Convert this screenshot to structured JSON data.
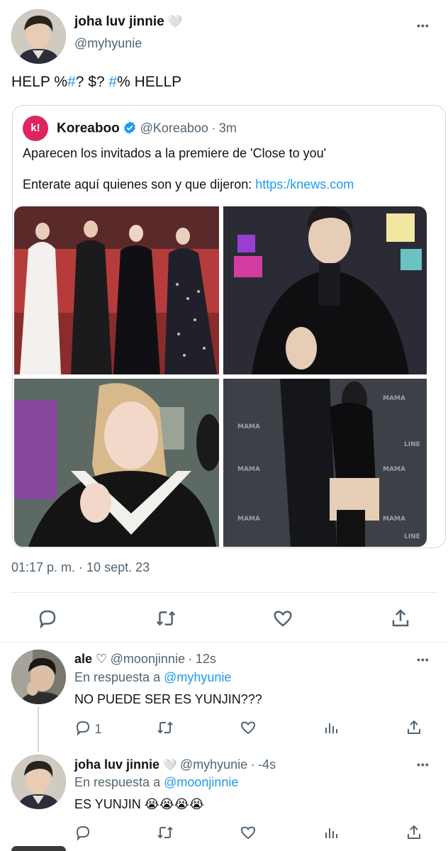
{
  "main_tweet": {
    "display_name": "joha luv jinnie",
    "heart_emoji": "🤍",
    "handle": "@myhyunie",
    "more_label": "•••",
    "text_parts": [
      "HELP %",
      "#",
      "? $? ",
      "#",
      "% HELLP"
    ],
    "quote": {
      "avatar_letter": "k!",
      "display_name": "Koreaboo",
      "handle": "@Koreaboo",
      "separator": "·",
      "time": "3m",
      "line1": "Aparecen los invitados a la premiere de 'Close to you'",
      "line2_prefix": "Enterate aquí quienes son y que dijeron: ",
      "line2_link": "https:/knews.com"
    },
    "timestamp": "01:17 p. m. · 10 sept. 23"
  },
  "replies": [
    {
      "display_name": "ale ♡",
      "handle": "@moonjinnie",
      "separator": "·",
      "time": "12s",
      "reply_to_label": "En respuesta a",
      "reply_to_handle": "@myhyunie",
      "text": "NO PUEDE SER ES YUNJIN???",
      "reply_count": "1"
    },
    {
      "display_name": "joha luv jinnie",
      "heart_emoji": "🤍",
      "handle": "@myhyunie",
      "separator": "·",
      "time": "-4s",
      "reply_to_label": "En respuesta a",
      "reply_to_handle": "@moonjinnie",
      "text": "ES YUNJIN",
      "emojis": "😭😭😭😭"
    }
  ],
  "colors": {
    "accent": "#1d9bf0",
    "muted": "#536471",
    "verified": "#1d9bf0",
    "koreaboo": "#e0245e"
  }
}
